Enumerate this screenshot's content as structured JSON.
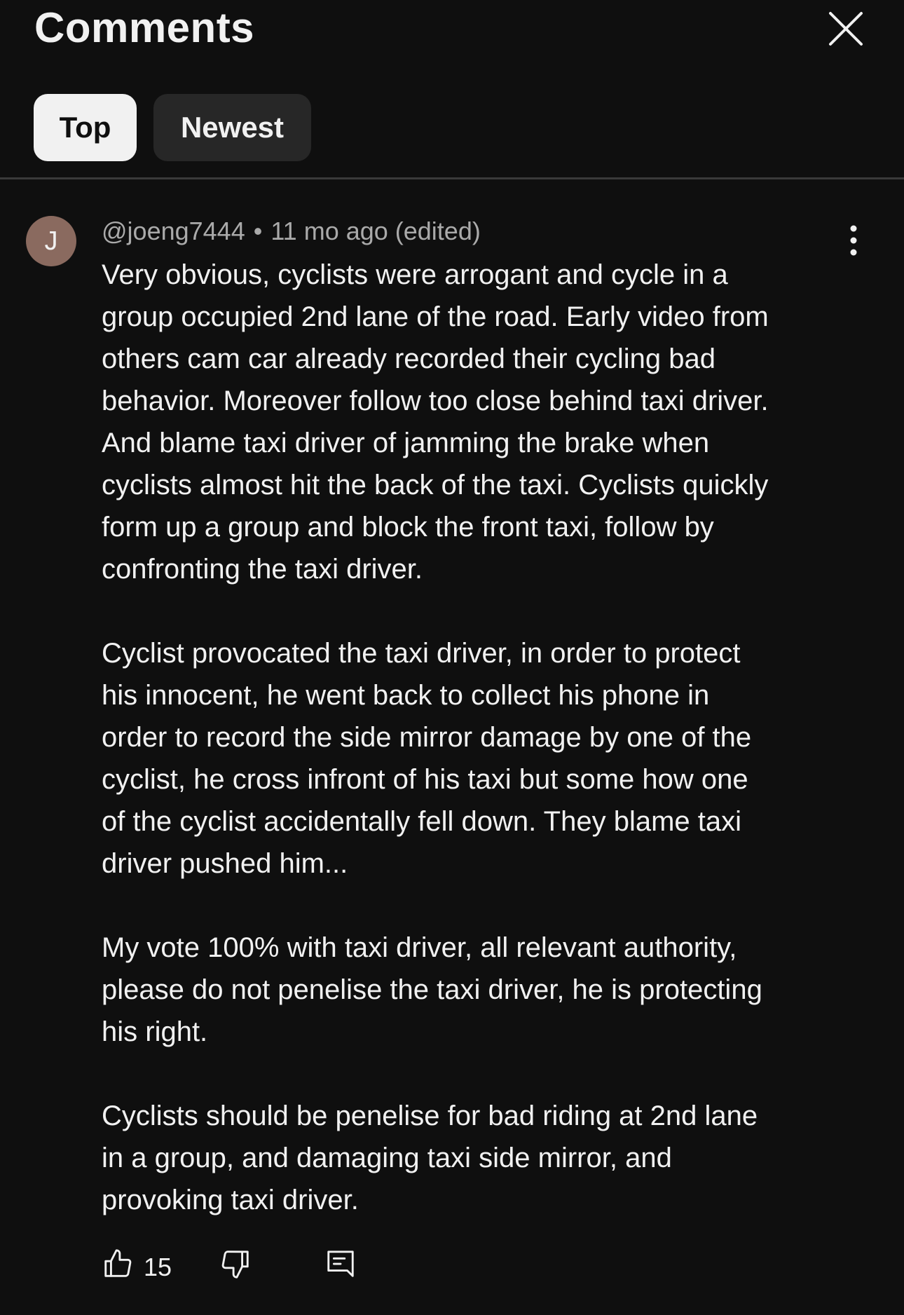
{
  "header": {
    "title": "Comments",
    "close_icon": "close-icon"
  },
  "sort_tabs": [
    {
      "label": "Top",
      "selected": true
    },
    {
      "label": "Newest",
      "selected": false
    }
  ],
  "comment": {
    "avatar_initial": "J",
    "avatar_color": "#8a6a5f",
    "author": "@joeng7444",
    "separator": "•",
    "time": "11 mo ago (edited)",
    "menu_icon": "more-vertical-icon",
    "paragraphs": [
      [
        "Very obvious, cyclists were arrogant and cycle in a",
        "group occupied 2nd lane of the road. Early video from",
        "others cam car already recorded their cycling bad",
        "behavior. Moreover follow too close behind taxi driver.",
        "And blame taxi driver of jamming the brake when",
        "cyclists almost hit the back of the taxi. Cyclists quickly",
        "form up a group and block the front taxi, follow by",
        "confronting the taxi driver."
      ],
      [
        "Cyclist provocated the taxi driver, in order to protect",
        "his innocent, he went back to collect his phone in",
        "order to record the side mirror damage by one of the",
        "cyclist, he cross infront of his taxi but some how one",
        "of the cyclist accidentally fell down. They blame taxi",
        "driver pushed him..."
      ],
      [
        "My vote 100% with taxi driver, all relevant authority,",
        "please do not penelise the taxi driver, he is protecting",
        "his right."
      ],
      [
        "Cyclists should be penelise for bad riding at 2nd lane",
        "in a group, and damaging taxi side mirror, and",
        "provoking taxi driver."
      ]
    ],
    "like_count": "15",
    "like_icon": "thumbs-up-icon",
    "dislike_icon": "thumbs-down-icon",
    "reply_icon": "reply-icon"
  },
  "colors": {
    "background": "#0f0f0f",
    "text": "#f1f1f1",
    "secondary_text": "#aaaaaa",
    "chip_selected_bg": "#f1f1f1",
    "chip_bg": "#272727"
  }
}
